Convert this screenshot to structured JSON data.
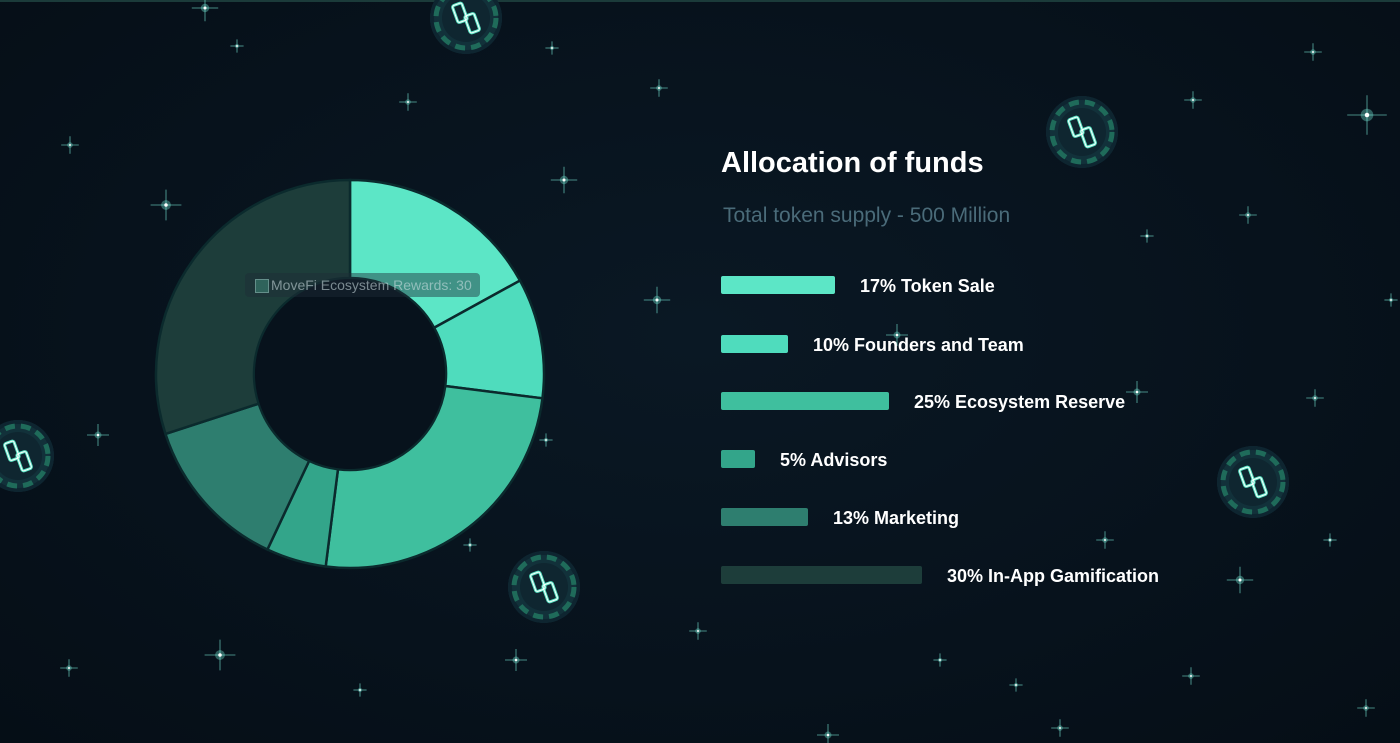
{
  "page": {
    "title": "Allocation of funds",
    "subtitle": "Total token supply - 500 Million"
  },
  "tooltip": {
    "text": "MoveFi Ecosystem Rewards: 30"
  },
  "colors": {
    "background": "#07121c",
    "token_sale": "#5ce6c6",
    "founders": "#4fdcbd",
    "ecosystem_reserve": "#3fbf9e",
    "advisors": "#33a58a",
    "marketing": "#2e7e6f",
    "gamification": "#1d3d3a",
    "star": "#7ff7e3"
  },
  "chart_data": {
    "type": "pie",
    "donut": true,
    "title": "Allocation of funds",
    "subtitle": "Total token supply - 500 Million",
    "categories": [
      "Token Sale",
      "Founders and Team",
      "Ecosystem Reserve",
      "Advisors",
      "Marketing",
      "In-App Gamification"
    ],
    "values": [
      17,
      10,
      25,
      5,
      13,
      30
    ],
    "unit": "%",
    "legend_labels": [
      "17% Token Sale",
      "10% Founders and Team",
      "25% Ecosystem Reserve",
      "5% Advisors",
      "13% Marketing",
      "30% In-App Gamification"
    ],
    "legend_placement": "right",
    "grid": false
  }
}
